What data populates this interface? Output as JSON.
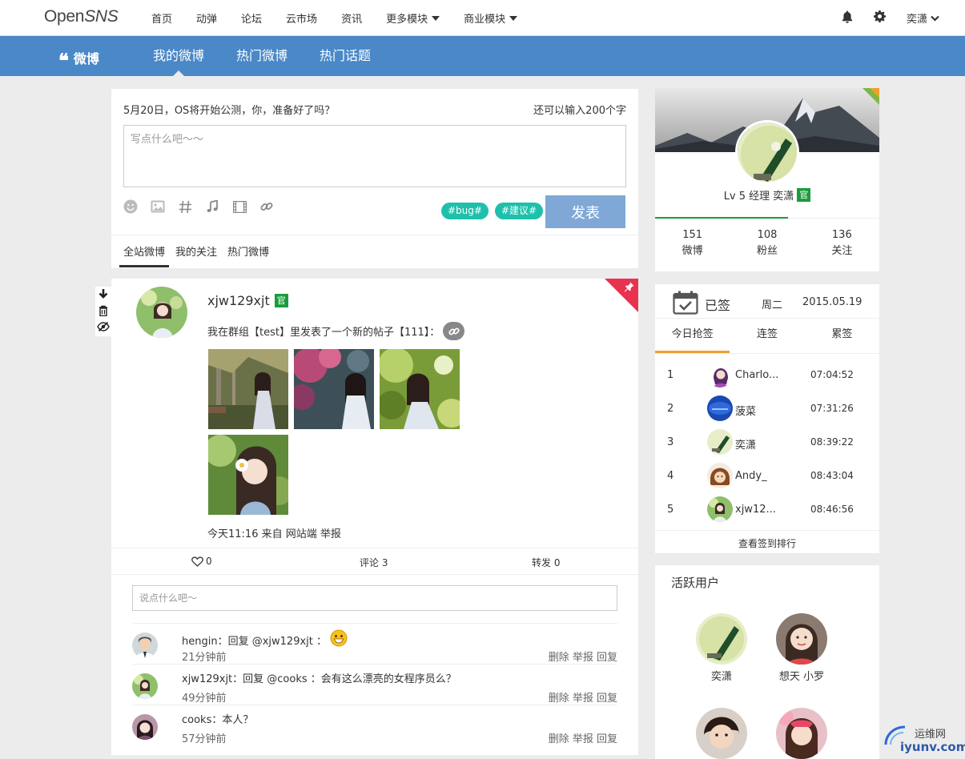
{
  "topnav": {
    "logo_main": "Open",
    "logo_italic": "SNS",
    "items": [
      "首页",
      "动弹",
      "论坛",
      "云市场",
      "资讯",
      "更多模块",
      "商业模块"
    ],
    "username": "奕潇"
  },
  "subnav": {
    "brand": "微博",
    "tabs": [
      "我的微博",
      "热门微博",
      "热门话题"
    ]
  },
  "compose": {
    "notice": "5月20日，OS将开始公测，你，准备好了吗？",
    "remaining": "还可以输入200个字",
    "placeholder": "写点什么吧～～",
    "tags": [
      "#bug#",
      "#建议#"
    ],
    "submit_label": "发表",
    "feed_tabs": [
      "全站微博",
      "我的关注",
      "热门微博"
    ]
  },
  "post": {
    "author": "xjw129xjt",
    "verified_badge": "官",
    "text": "我在群组【test】里发表了一个新的帖子【111】：",
    "meta": "今天11:16 来自 网站端 举报",
    "likes": "0",
    "comments_label": "评论 3",
    "forwards_label": "转发 0",
    "comment_placeholder": "说点什么吧～",
    "comments": [
      {
        "text": "hengin：回复 @xjw129xjt ：",
        "time": "21分钟前",
        "actions": "删除 举报 回复"
      },
      {
        "text": "xjw129xjt：回复 @cooks ：会有这么漂亮的女程序员么？",
        "time": "49分钟前",
        "actions": "删除 举报 回复"
      },
      {
        "text": "cooks：本人？",
        "time": "57分钟前",
        "actions": "删除 举报 回复"
      }
    ]
  },
  "profile": {
    "level_name": "Lv 5 经理 奕潇",
    "badge": "官",
    "stats": [
      {
        "value": "151",
        "label": "微博"
      },
      {
        "value": "108",
        "label": "粉丝"
      },
      {
        "value": "136",
        "label": "关注"
      }
    ]
  },
  "checkin": {
    "title": "已签",
    "weekday": "周二",
    "date": "2015.05.19",
    "tabs": [
      "今日抢签",
      "连签",
      "累签"
    ],
    "rows": [
      {
        "rank": "1",
        "name": "Charlo...",
        "time": "07:04:52"
      },
      {
        "rank": "2",
        "name": "菠菜",
        "time": "07:31:26"
      },
      {
        "rank": "3",
        "name": "奕潇",
        "time": "08:39:22"
      },
      {
        "rank": "4",
        "name": "Andy_",
        "time": "08:43:04"
      },
      {
        "rank": "5",
        "name": "xjw12...",
        "time": "08:46:56"
      }
    ],
    "footer": "查看签到排行"
  },
  "active_users": {
    "title": "活跃用户",
    "users": [
      "奕潇",
      "想天 小罗"
    ]
  },
  "watermark": {
    "cn": "运维网",
    "url": "iyunv.com"
  },
  "colors": {
    "nav_blue": "#4a88c7",
    "tag_teal": "#1ec0ac",
    "badge_green": "#1a9c3c",
    "pin_red": "#e83350",
    "tab_orange": "#f0a030"
  }
}
